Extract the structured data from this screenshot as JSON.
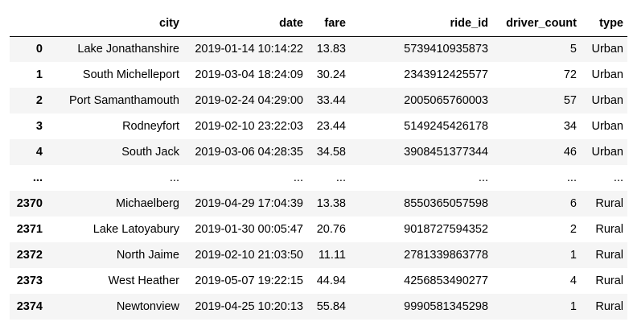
{
  "table": {
    "index_header": "",
    "columns": [
      "city",
      "date",
      "fare",
      "ride_id",
      "driver_count",
      "type"
    ],
    "rows": [
      {
        "index": "0",
        "cells": [
          "Lake Jonathanshire",
          "2019-01-14 10:14:22",
          "13.83",
          "5739410935873",
          "5",
          "Urban"
        ]
      },
      {
        "index": "1",
        "cells": [
          "South Michelleport",
          "2019-03-04 18:24:09",
          "30.24",
          "2343912425577",
          "72",
          "Urban"
        ]
      },
      {
        "index": "2",
        "cells": [
          "Port Samanthamouth",
          "2019-02-24 04:29:00",
          "33.44",
          "2005065760003",
          "57",
          "Urban"
        ]
      },
      {
        "index": "3",
        "cells": [
          "Rodneyfort",
          "2019-02-10 23:22:03",
          "23.44",
          "5149245426178",
          "34",
          "Urban"
        ]
      },
      {
        "index": "4",
        "cells": [
          "South Jack",
          "2019-03-06 04:28:35",
          "34.58",
          "3908451377344",
          "46",
          "Urban"
        ]
      },
      {
        "index": "...",
        "cells": [
          "...",
          "...",
          "...",
          "...",
          "...",
          "..."
        ]
      },
      {
        "index": "2370",
        "cells": [
          "Michaelberg",
          "2019-04-29 17:04:39",
          "13.38",
          "8550365057598",
          "6",
          "Rural"
        ]
      },
      {
        "index": "2371",
        "cells": [
          "Lake Latoyabury",
          "2019-01-30 00:05:47",
          "20.76",
          "9018727594352",
          "2",
          "Rural"
        ]
      },
      {
        "index": "2372",
        "cells": [
          "North Jaime",
          "2019-02-10 21:03:50",
          "11.11",
          "2781339863778",
          "1",
          "Rural"
        ]
      },
      {
        "index": "2373",
        "cells": [
          "West Heather",
          "2019-05-07 19:22:15",
          "44.94",
          "4256853490277",
          "4",
          "Rural"
        ]
      },
      {
        "index": "2374",
        "cells": [
          "Newtonview",
          "2019-04-25 10:20:13",
          "55.84",
          "9990581345298",
          "1",
          "Rural"
        ]
      }
    ]
  },
  "colors": {
    "striped_row": "#f5f5f5",
    "header_border": "#000000",
    "text": "#000000"
  }
}
